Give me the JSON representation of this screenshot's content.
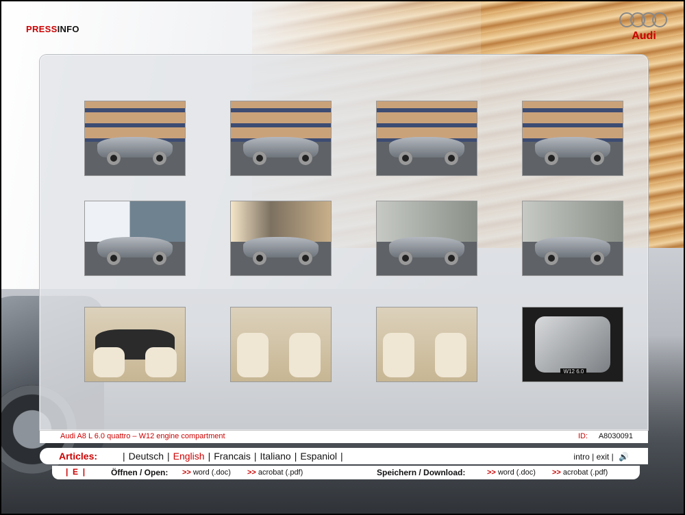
{
  "header": {
    "press": "PRESS",
    "info": "INFO",
    "brand": "Audi"
  },
  "gallery": {
    "thumbnails": [
      {
        "scene": "building"
      },
      {
        "scene": "building"
      },
      {
        "scene": "building"
      },
      {
        "scene": "building"
      },
      {
        "scene": "glass"
      },
      {
        "scene": "blur"
      },
      {
        "scene": "blur2"
      },
      {
        "scene": "blur2"
      },
      {
        "scene": "interior-dashboard"
      },
      {
        "scene": "interior-rear-man"
      },
      {
        "scene": "interior-rear-woman"
      },
      {
        "scene": "engine"
      }
    ],
    "engine_badge": "W12 6.0"
  },
  "caption": {
    "text": "Audi A8 L 6.0 quattro – W12 engine compartment",
    "id_label": "ID:",
    "id_value": "A8030091"
  },
  "articles": {
    "label": "Articles:",
    "languages": [
      "Deutsch",
      "English",
      "Francais",
      "Italiano",
      "Espaniol"
    ],
    "active": "English",
    "intro": "intro",
    "exit": "exit"
  },
  "download": {
    "lang_code": "E",
    "open_label": "Öffnen / Open:",
    "save_label": "Speichern / Download:",
    "word": "word (.doc)",
    "acrobat": "acrobat (.pdf)",
    "arrow": ">>"
  },
  "colors": {
    "accent": "#cc0000"
  }
}
